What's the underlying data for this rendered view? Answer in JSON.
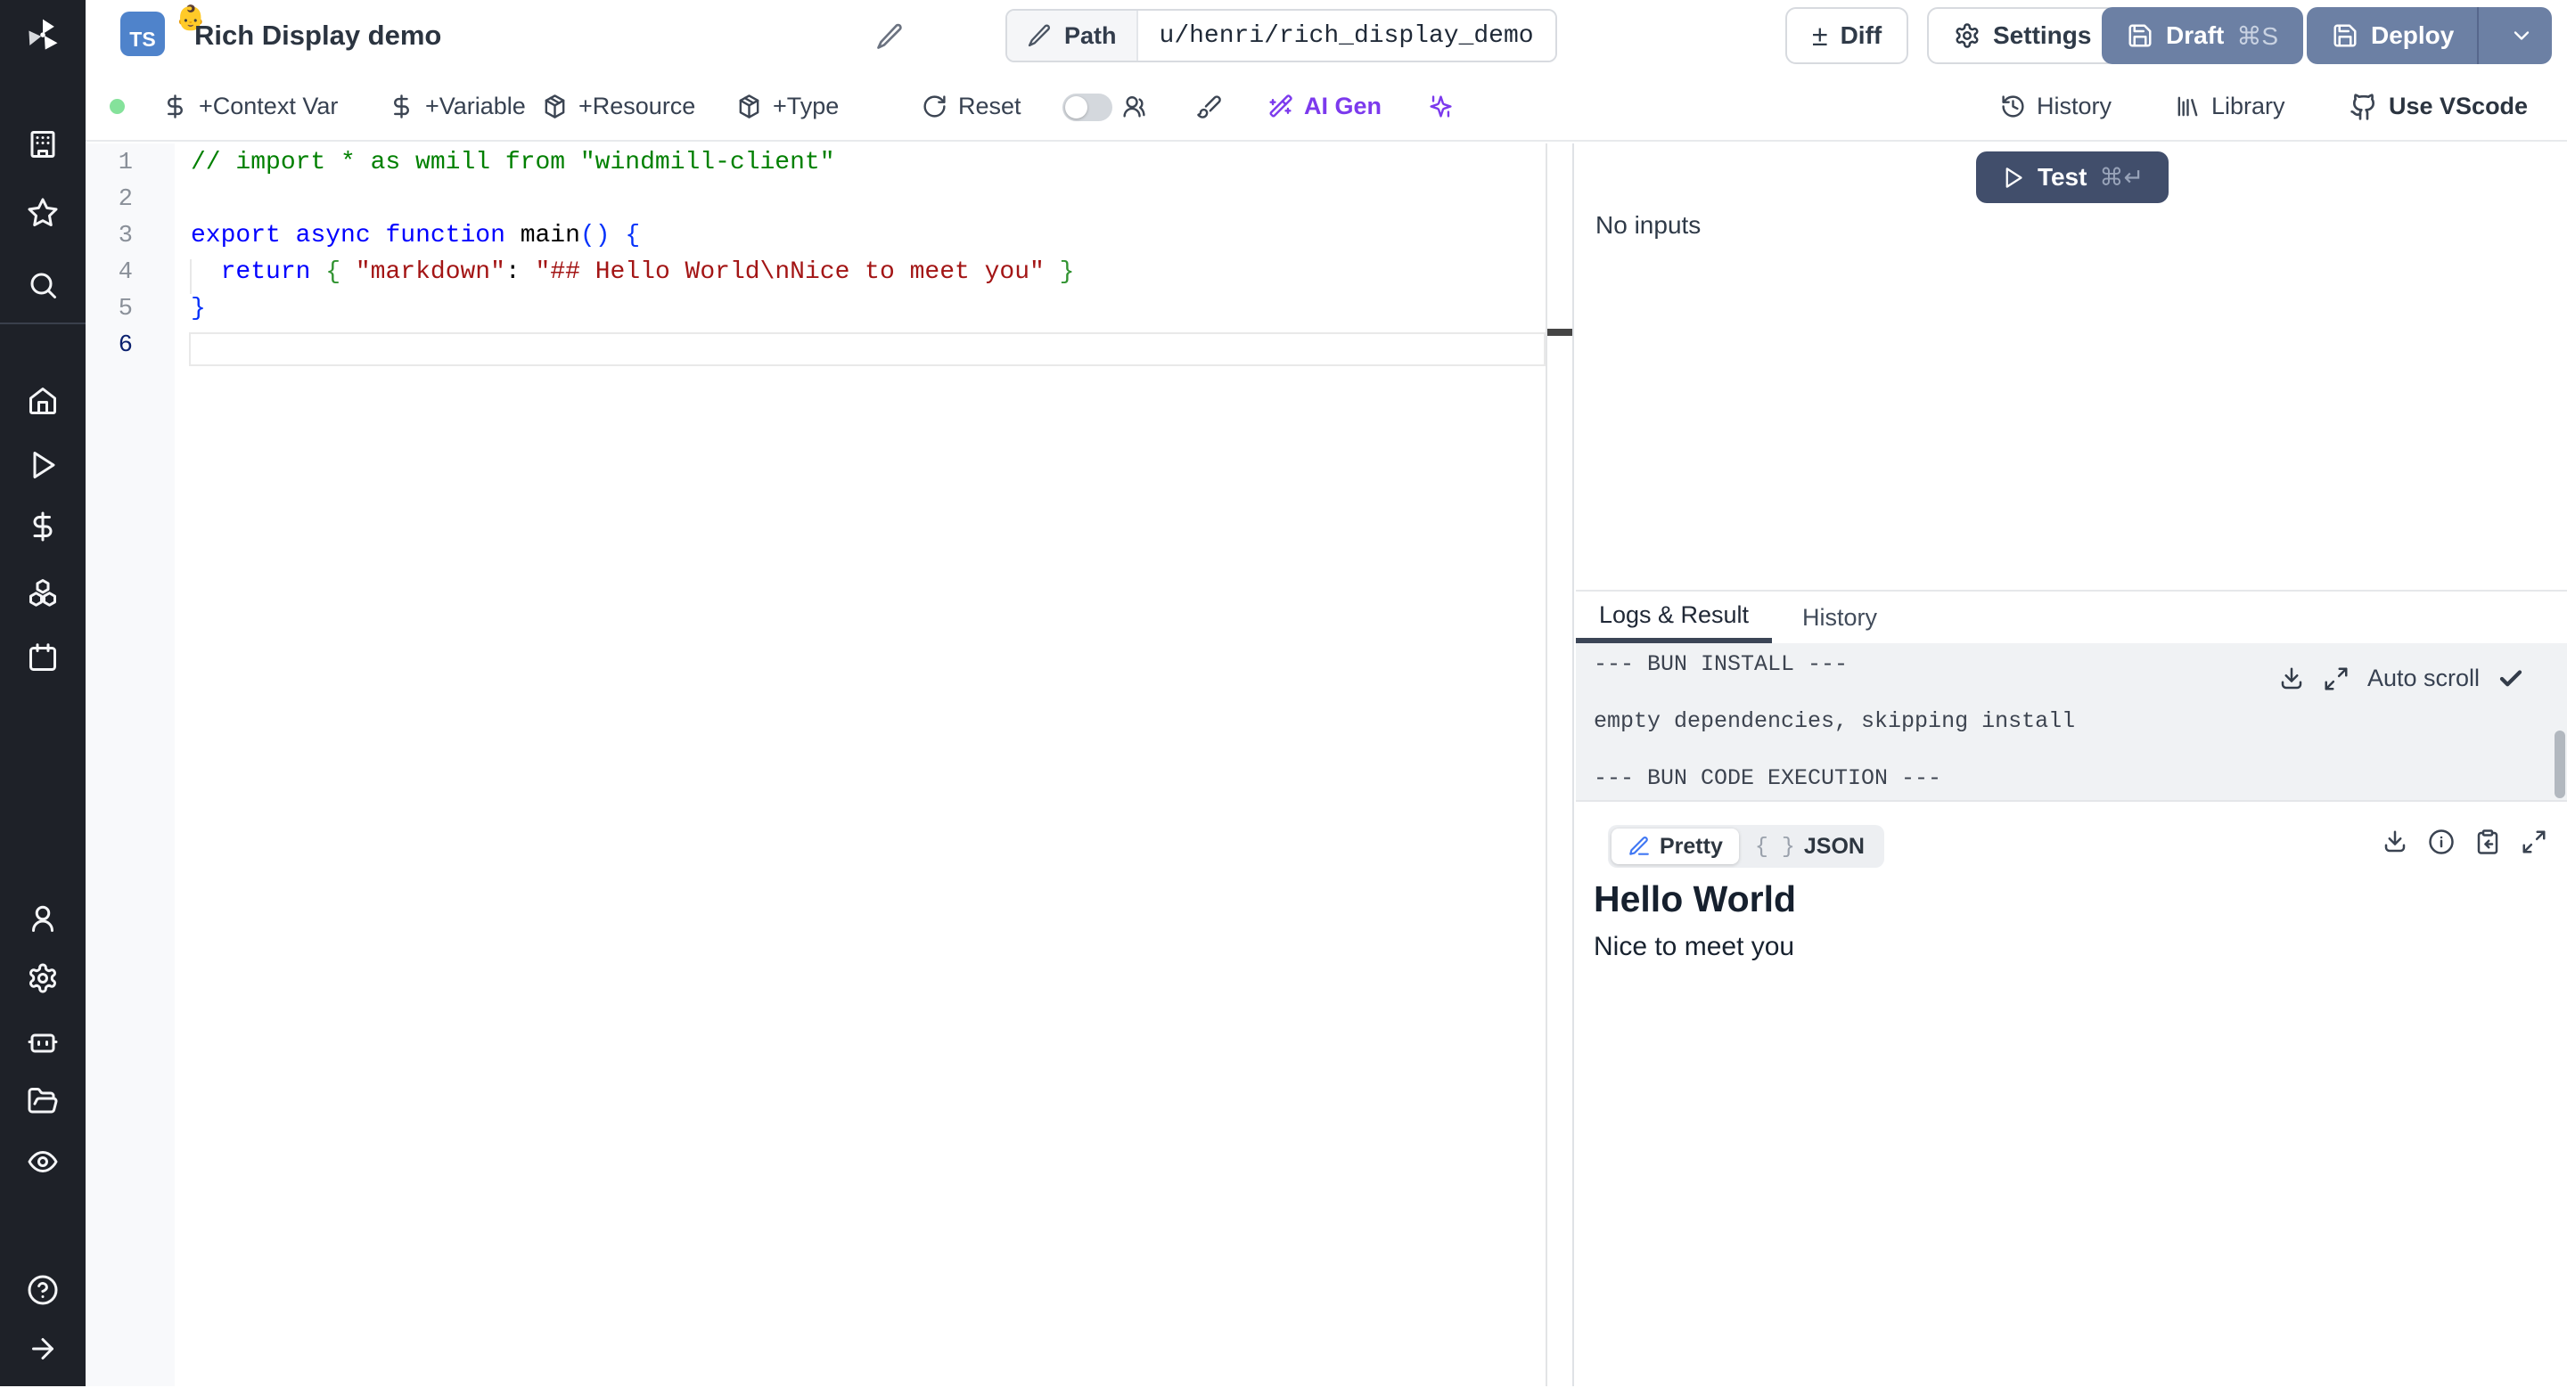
{
  "app": {
    "name": "Windmill"
  },
  "colors": {
    "sidebar_bg": "#1e2128",
    "accent_purple": "#7c3aed",
    "slate_button": "#6c80a4",
    "test_button": "#414e6b",
    "ts_badge_blue": "#4f83cb",
    "status_green": "#85e29b",
    "code_keyword": "#0000ff",
    "code_comment": "#008000",
    "code_string": "#a31515"
  },
  "sidebar": {
    "icons": [
      "windmill-logo",
      "building",
      "star",
      "search",
      "home",
      "play",
      "dollar",
      "boxes",
      "calendar",
      "user",
      "settings",
      "bot",
      "folder-open",
      "eye",
      "help-circle",
      "arrow-right"
    ]
  },
  "header": {
    "language_badge": "TS",
    "badge_emoji": "👶",
    "script_title": "Rich Display demo",
    "path_label": "Path",
    "path_value": "u/henri/rich_display_demo",
    "diff_label": "Diff",
    "diff_symbol": "±",
    "settings_label": "Settings",
    "draft_label": "Draft",
    "draft_shortcut": "⌘S",
    "deploy_label": "Deploy"
  },
  "toolbar": {
    "add_context_var": "+Context Var",
    "add_variable": "+Variable",
    "add_resource": "+Resource",
    "add_type": "+Type",
    "reset": "Reset",
    "ai_gen": "AI Gen",
    "history": "History",
    "library": "Library",
    "use_vscode": "Use VScode"
  },
  "editor": {
    "lines": [
      {
        "num": "1",
        "tokens": [
          {
            "c": "comment",
            "t": "// import * as wmill from \"windmill-client\""
          }
        ]
      },
      {
        "num": "2",
        "tokens": []
      },
      {
        "num": "3",
        "tokens": [
          {
            "c": "kw",
            "t": "export"
          },
          {
            "c": "pl",
            "t": " "
          },
          {
            "c": "kw",
            "t": "async"
          },
          {
            "c": "pl",
            "t": " "
          },
          {
            "c": "kw",
            "t": "function"
          },
          {
            "c": "pl",
            "t": " "
          },
          {
            "c": "fn",
            "t": "main"
          },
          {
            "c": "b1",
            "t": "() {"
          }
        ]
      },
      {
        "num": "4",
        "tokens": [
          {
            "c": "pl",
            "t": "  "
          },
          {
            "c": "kw",
            "t": "return"
          },
          {
            "c": "pl",
            "t": " "
          },
          {
            "c": "b2",
            "t": "{"
          },
          {
            "c": "pl",
            "t": " "
          },
          {
            "c": "str",
            "t": "\"markdown\""
          },
          {
            "c": "pl",
            "t": ": "
          },
          {
            "c": "str",
            "t": "\"## Hello World\\nNice to meet you\""
          },
          {
            "c": "pl",
            "t": " "
          },
          {
            "c": "b2",
            "t": "}"
          }
        ]
      },
      {
        "num": "5",
        "tokens": [
          {
            "c": "b1",
            "t": "}"
          }
        ]
      },
      {
        "num": "6",
        "tokens": [],
        "current": true
      }
    ]
  },
  "inputs_panel": {
    "test_label": "Test",
    "test_shortcut": "⌘↵",
    "empty_text": "No inputs"
  },
  "logs_panel": {
    "tabs": [
      "Logs & Result",
      "History"
    ],
    "active_tab": "Logs & Result",
    "lines": [
      "--- BUN INSTALL ---",
      "empty dependencies, skipping install",
      "--- BUN CODE EXECUTION ---"
    ],
    "auto_scroll_label": "Auto scroll",
    "auto_scroll_checked": true
  },
  "result_panel": {
    "view_modes": [
      "Pretty",
      "JSON"
    ],
    "active_mode": "Pretty",
    "heading": "Hello World",
    "body": "Nice to meet you"
  }
}
